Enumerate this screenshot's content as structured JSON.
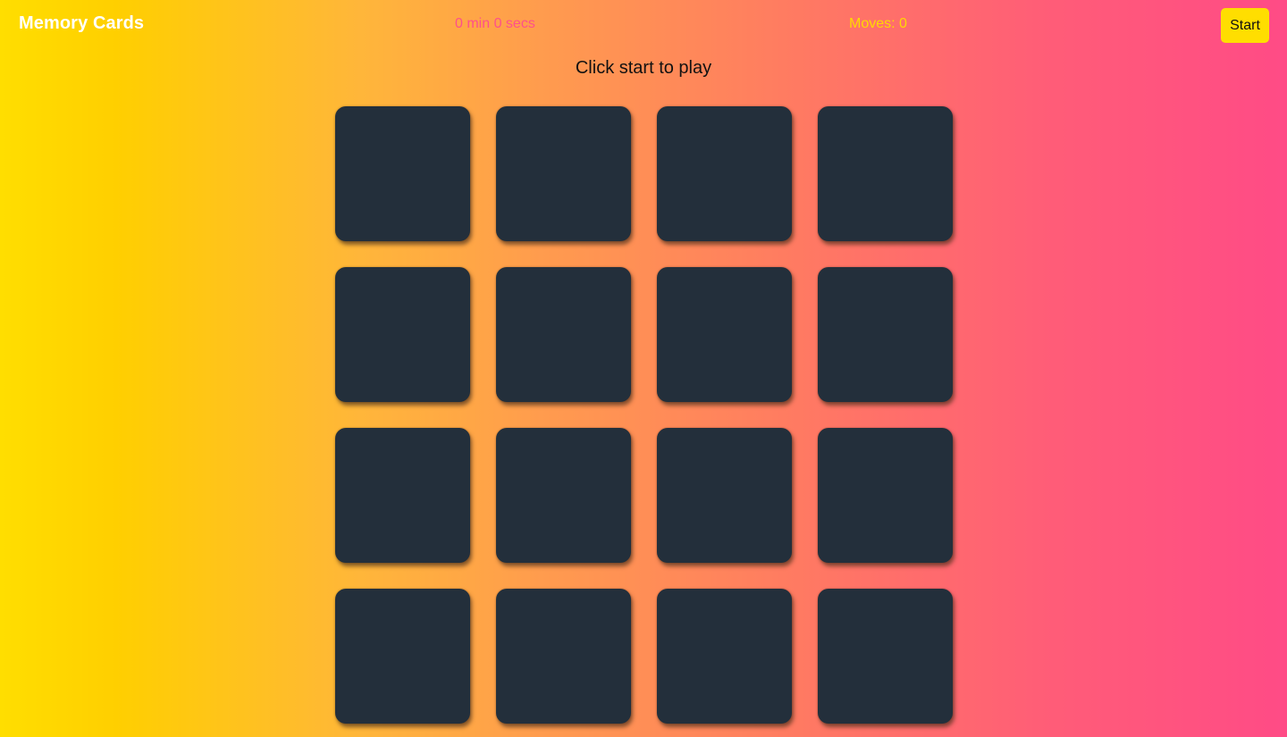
{
  "header": {
    "title": "Memory Cards",
    "timer": "0 min 0 secs",
    "moves": "Moves: 0",
    "start_label": "Start"
  },
  "status": "Click start to play",
  "board": {
    "rows": 4,
    "columns": 4,
    "cards_face_down": 16
  },
  "colors": {
    "gradient_start": "#ffde00",
    "gradient_end": "#ff4b86",
    "card_back": "#232f3b",
    "timer_text": "#ff4f8b",
    "moves_text": "#ffd800",
    "button_bg": "#ffde00"
  }
}
